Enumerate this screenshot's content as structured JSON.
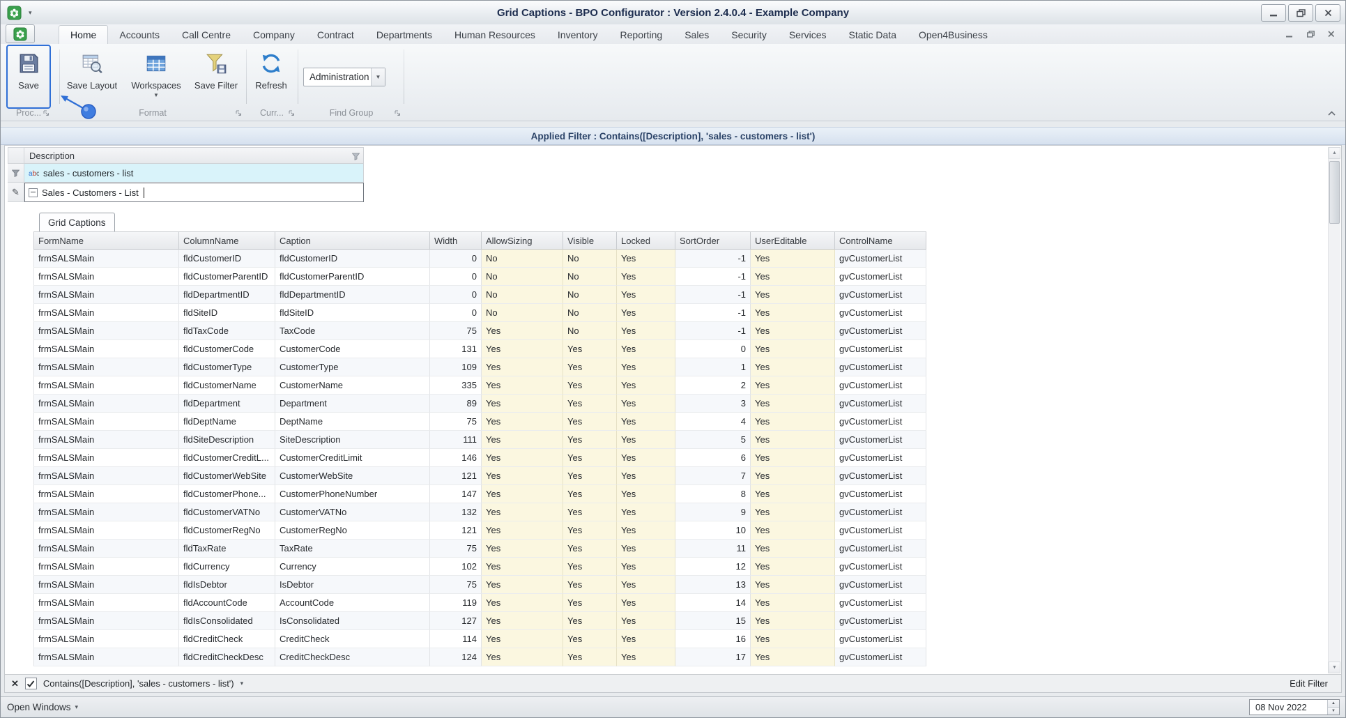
{
  "window": {
    "title": "Grid Captions - BPO Configurator : Version 2.4.0.4 - Example Company"
  },
  "ribbon": {
    "tabs": [
      "Home",
      "Accounts",
      "Call Centre",
      "Company",
      "Contract",
      "Departments",
      "Human Resources",
      "Inventory",
      "Reporting",
      "Sales",
      "Security",
      "Services",
      "Static Data",
      "Open4Business"
    ],
    "active_tab": "Home",
    "buttons": {
      "save": "Save",
      "save_layout": "Save Layout",
      "workspaces": "Workspaces",
      "save_filter": "Save Filter",
      "refresh": "Refresh"
    },
    "find_group_value": "Administration",
    "groups": {
      "process": "Proc...",
      "format": "Format",
      "current": "Curr...",
      "find": "Find Group"
    }
  },
  "applied_filter_bar": "Applied Filter : Contains([Description], 'sales - customers - list')",
  "master_grid": {
    "column_header": "Description",
    "filter_row_value": "sales - customers - list",
    "edit_row_value": "Sales - Customers - List"
  },
  "detail": {
    "tab": "Grid Captions",
    "columns": [
      "FormName",
      "ColumnName",
      "Caption",
      "Width",
      "AllowSizing",
      "Visible",
      "Locked",
      "SortOrder",
      "UserEditable",
      "ControlName"
    ],
    "rows": [
      [
        "frmSALSMain",
        "fldCustomerID",
        "fldCustomerID",
        "0",
        "No",
        "No",
        "Yes",
        "-1",
        "Yes",
        "gvCustomerList"
      ],
      [
        "frmSALSMain",
        "fldCustomerParentID",
        "fldCustomerParentID",
        "0",
        "No",
        "No",
        "Yes",
        "-1",
        "Yes",
        "gvCustomerList"
      ],
      [
        "frmSALSMain",
        "fldDepartmentID",
        "fldDepartmentID",
        "0",
        "No",
        "No",
        "Yes",
        "-1",
        "Yes",
        "gvCustomerList"
      ],
      [
        "frmSALSMain",
        "fldSiteID",
        "fldSiteID",
        "0",
        "No",
        "No",
        "Yes",
        "-1",
        "Yes",
        "gvCustomerList"
      ],
      [
        "frmSALSMain",
        "fldTaxCode",
        "TaxCode",
        "75",
        "Yes",
        "No",
        "Yes",
        "-1",
        "Yes",
        "gvCustomerList"
      ],
      [
        "frmSALSMain",
        "fldCustomerCode",
        "CustomerCode",
        "131",
        "Yes",
        "Yes",
        "Yes",
        "0",
        "Yes",
        "gvCustomerList"
      ],
      [
        "frmSALSMain",
        "fldCustomerType",
        "CustomerType",
        "109",
        "Yes",
        "Yes",
        "Yes",
        "1",
        "Yes",
        "gvCustomerList"
      ],
      [
        "frmSALSMain",
        "fldCustomerName",
        "CustomerName",
        "335",
        "Yes",
        "Yes",
        "Yes",
        "2",
        "Yes",
        "gvCustomerList"
      ],
      [
        "frmSALSMain",
        "fldDepartment",
        "Department",
        "89",
        "Yes",
        "Yes",
        "Yes",
        "3",
        "Yes",
        "gvCustomerList"
      ],
      [
        "frmSALSMain",
        "fldDeptName",
        "DeptName",
        "75",
        "Yes",
        "Yes",
        "Yes",
        "4",
        "Yes",
        "gvCustomerList"
      ],
      [
        "frmSALSMain",
        "fldSiteDescription",
        "SiteDescription",
        "111",
        "Yes",
        "Yes",
        "Yes",
        "5",
        "Yes",
        "gvCustomerList"
      ],
      [
        "frmSALSMain",
        "fldCustomerCreditL...",
        "CustomerCreditLimit",
        "146",
        "Yes",
        "Yes",
        "Yes",
        "6",
        "Yes",
        "gvCustomerList"
      ],
      [
        "frmSALSMain",
        "fldCustomerWebSite",
        "CustomerWebSite",
        "121",
        "Yes",
        "Yes",
        "Yes",
        "7",
        "Yes",
        "gvCustomerList"
      ],
      [
        "frmSALSMain",
        "fldCustomerPhone...",
        "CustomerPhoneNumber",
        "147",
        "Yes",
        "Yes",
        "Yes",
        "8",
        "Yes",
        "gvCustomerList"
      ],
      [
        "frmSALSMain",
        "fldCustomerVATNo",
        "CustomerVATNo",
        "132",
        "Yes",
        "Yes",
        "Yes",
        "9",
        "Yes",
        "gvCustomerList"
      ],
      [
        "frmSALSMain",
        "fldCustomerRegNo",
        "CustomerRegNo",
        "121",
        "Yes",
        "Yes",
        "Yes",
        "10",
        "Yes",
        "gvCustomerList"
      ],
      [
        "frmSALSMain",
        "fldTaxRate",
        "TaxRate",
        "75",
        "Yes",
        "Yes",
        "Yes",
        "11",
        "Yes",
        "gvCustomerList"
      ],
      [
        "frmSALSMain",
        "fldCurrency",
        "Currency",
        "102",
        "Yes",
        "Yes",
        "Yes",
        "12",
        "Yes",
        "gvCustomerList"
      ],
      [
        "frmSALSMain",
        "fldIsDebtor",
        "IsDebtor",
        "75",
        "Yes",
        "Yes",
        "Yes",
        "13",
        "Yes",
        "gvCustomerList"
      ],
      [
        "frmSALSMain",
        "fldAccountCode",
        "AccountCode",
        "119",
        "Yes",
        "Yes",
        "Yes",
        "14",
        "Yes",
        "gvCustomerList"
      ],
      [
        "frmSALSMain",
        "fldIsConsolidated",
        "IsConsolidated",
        "127",
        "Yes",
        "Yes",
        "Yes",
        "15",
        "Yes",
        "gvCustomerList"
      ],
      [
        "frmSALSMain",
        "fldCreditCheck",
        "CreditCheck",
        "114",
        "Yes",
        "Yes",
        "Yes",
        "16",
        "Yes",
        "gvCustomerList"
      ],
      [
        "frmSALSMain",
        "fldCreditCheckDesc",
        "CreditCheckDesc",
        "124",
        "Yes",
        "Yes",
        "Yes",
        "17",
        "Yes",
        "gvCustomerList"
      ]
    ]
  },
  "filter_panel": {
    "text": "Contains([Description], 'sales - customers - list')",
    "edit_filter": "Edit Filter"
  },
  "status_bar": {
    "open_windows": "Open Windows",
    "date": "08 Nov 2022"
  },
  "colors": {
    "coach_accent_blue": "#2f6fd6",
    "auto_filter_row_bg": "#d9f3fa",
    "readonly_cell_bg": "#fbf7e0",
    "applied_bar_bg": "#dce6f2"
  }
}
